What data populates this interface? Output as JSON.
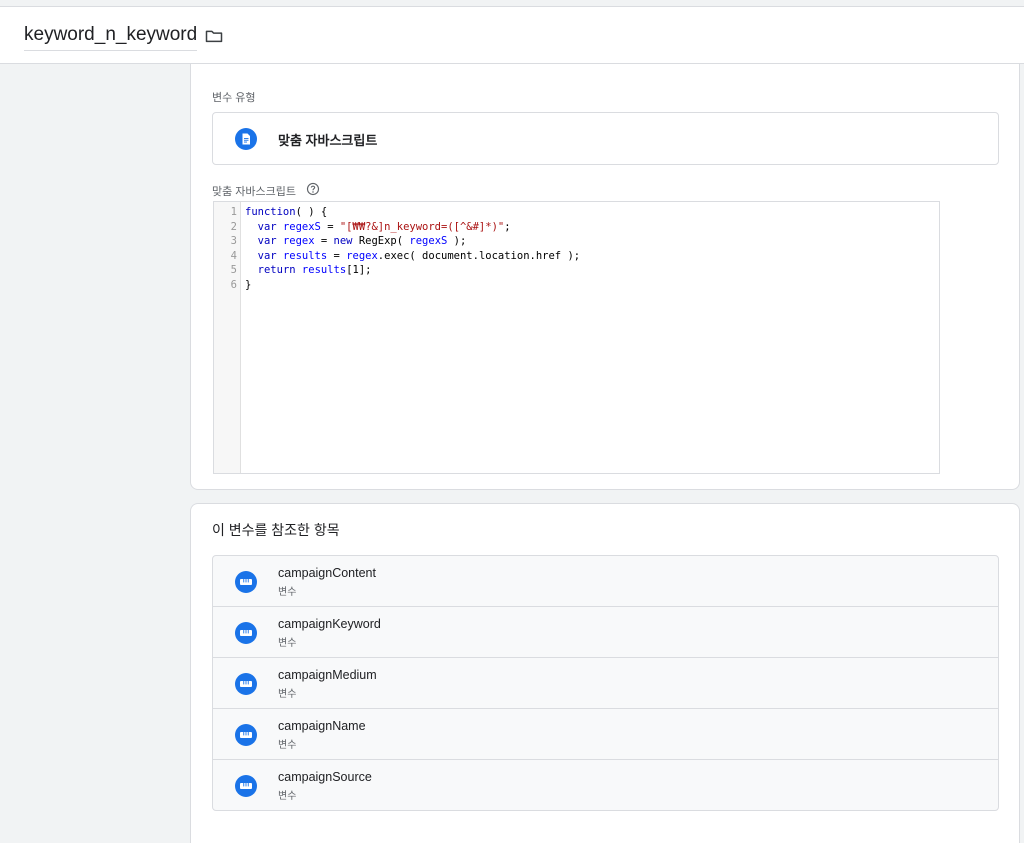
{
  "header": {
    "title": "keyword_n_keyword",
    "folder_icon": "folder-icon"
  },
  "variable_type": {
    "section_label": "변수 유형",
    "type_name": "맞춤 자바스크립트",
    "icon": "document-icon",
    "icon_color": "#1a73e8"
  },
  "custom_js": {
    "label": "맞춤 자바스크립트",
    "help_icon": "help-circle-icon",
    "line_numbers": [
      "1",
      "2",
      "3",
      "4",
      "5",
      "6"
    ],
    "code_lines": [
      "function( ) {",
      "  var regexS = \"[₩₩?&]n_keyword=([^&#]*)\";",
      "  var regex = new RegExp( regexS );",
      "  var results = regex.exec( document.location.href );",
      "  return results[1];",
      "}"
    ]
  },
  "references": {
    "title": "이 변수를 참조한 항목",
    "item_icon": "variable-icon",
    "items": [
      {
        "name": "campaignContent",
        "type": "변수"
      },
      {
        "name": "campaignKeyword",
        "type": "변수"
      },
      {
        "name": "campaignMedium",
        "type": "변수"
      },
      {
        "name": "campaignName",
        "type": "변수"
      },
      {
        "name": "campaignSource",
        "type": "변수"
      }
    ]
  }
}
